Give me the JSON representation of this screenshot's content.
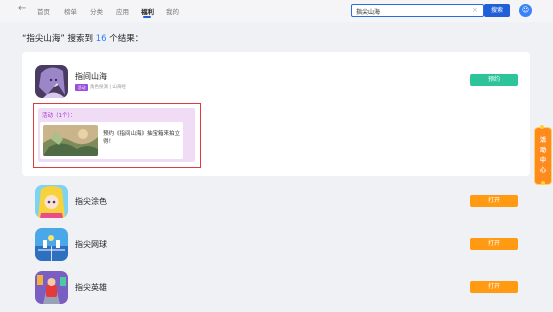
{
  "header": {
    "back_icon": "back-arrow-icon",
    "nav": [
      "首页",
      "榜单",
      "分类",
      "应用",
      "福利",
      "我的"
    ],
    "search_value": "指尖山海",
    "search_button": "搜索",
    "avatar_icon": "user-avatar-icon",
    "colors": {
      "accent": "#1f5fd8"
    }
  },
  "results": {
    "prefix": "“指尖山海” 搜索到 ",
    "count": "16",
    "suffix": " 个结果："
  },
  "featured": {
    "title": "指间山海",
    "tag": "活动",
    "subtitle": "角色扮演 | 山海经",
    "button": "预约",
    "event_label": "活动（1个）：",
    "event_text": "预约《指间山海》抽宝箱来拍立得！",
    "colors": {
      "reserve": "#2dc49a",
      "highlight": "#e23b3b"
    }
  },
  "items": [
    {
      "title": "指尖涂色",
      "button": "打开"
    },
    {
      "title": "指尖网球",
      "button": "打开"
    },
    {
      "title": "指尖英雄",
      "button": "打开"
    }
  ],
  "side_badge": {
    "text": "活动中心",
    "color": "#ff8a1e"
  }
}
